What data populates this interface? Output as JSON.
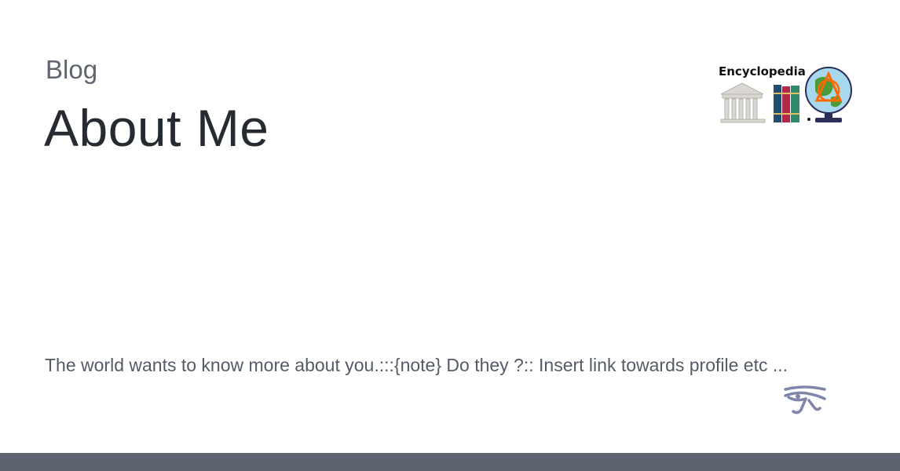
{
  "header": {
    "section": "Blog",
    "title": "About Me"
  },
  "summary": {
    "text": "The world wants to know more about you.:::{note} Do they ?:: Insert link towards profile etc ..."
  },
  "logo": {
    "wordmark": "Encyclopedia",
    "icon": "encyclopedia-logo-icon"
  },
  "decor": {
    "icon": "eye-of-horus-icon"
  },
  "colors": {
    "title": "#262a31",
    "text": "#555b66",
    "footer": "#5d636f"
  }
}
